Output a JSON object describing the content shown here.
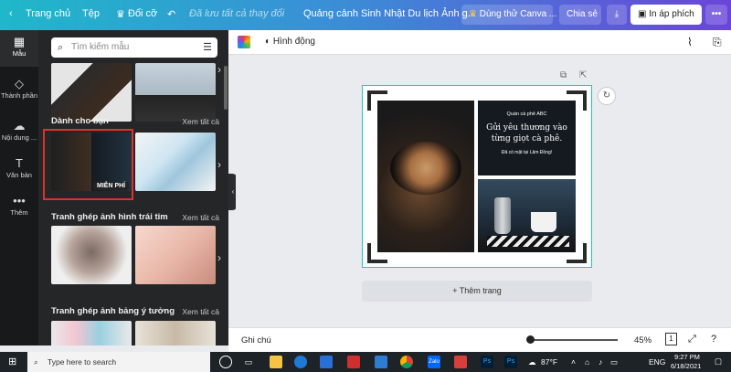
{
  "topbar": {
    "home": "Trang chủ",
    "file": "Tệp",
    "resize": "Đổi cỡ",
    "saved_status": "Đã lưu tất cả thay đổi",
    "design_title": "Quảng cảnh Sinh Nhật Du lịch Ảnh g...",
    "try_canva": "Dùng thử Canva ...",
    "share": "Chia sẻ",
    "print": "In áp phích"
  },
  "leftnav": {
    "items": [
      {
        "label": "Mẫu",
        "icon": "template-icon"
      },
      {
        "label": "Thành phần",
        "icon": "elements-icon"
      },
      {
        "label": "Nội dung ...",
        "icon": "upload-icon"
      },
      {
        "label": "Văn bản",
        "icon": "text-icon"
      },
      {
        "label": "Thêm",
        "icon": "more-icon"
      }
    ]
  },
  "panel": {
    "search_placeholder": "Tìm kiếm mẫu",
    "sections": [
      {
        "title": "Dành cho bạn",
        "see_all": "Xem tất cả"
      },
      {
        "title": "Tranh ghép ảnh hình trái tim",
        "see_all": "Xem tất cả"
      },
      {
        "title": "Tranh ghép ảnh bảng ý tưởng",
        "see_all": "Xem tất cả"
      }
    ],
    "free_badge": "MIỄN PHÍ"
  },
  "editor": {
    "animate": "Hình động",
    "add_page": "+ Thêm trang",
    "notes": "Ghi chú",
    "zoom": "45%",
    "page_count": "1"
  },
  "poster": {
    "shop_name": "Quán cà phê ABC",
    "headline_1": "Gửi yêu thương vào",
    "headline_2": "từng giọt cà phê.",
    "subline": "Đã có mặt tại Lâm Đồng!"
  },
  "taskbar": {
    "search": "Type here to search",
    "weather": "87°F",
    "lang": "ENG",
    "time": "9:27 PM",
    "date": "6/18/2021"
  },
  "colors": {
    "accent_teal": "#20c4cb",
    "selection_red": "#e03131",
    "panel_dark": "#252627"
  }
}
